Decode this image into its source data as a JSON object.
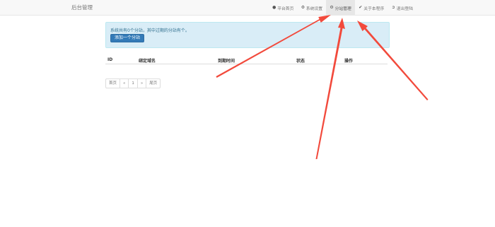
{
  "navbar": {
    "brand": "后台管理",
    "items": [
      {
        "label": "平台首页",
        "icon": "user-icon",
        "active": false
      },
      {
        "label": "系统设置",
        "icon": "gear-icon",
        "active": false
      },
      {
        "label": "分站管理",
        "icon": "gear-icon",
        "active": true
      },
      {
        "label": "关于本程序",
        "icon": "check-icon",
        "active": false
      },
      {
        "label": "退出登陆",
        "icon": "logout-icon",
        "active": false
      }
    ]
  },
  "alert": {
    "message": "系统共有0个分站，其中过期的分站有个。",
    "add_button_label": "添加一个分站"
  },
  "table": {
    "columns": [
      "ID",
      "绑定域名",
      "到期时间",
      "状态",
      "操作"
    ],
    "rows": []
  },
  "pagination": {
    "first": "首页",
    "prev": "«",
    "current": "1",
    "next": "»",
    "last": "尾页"
  },
  "colors": {
    "annotation_arrow": "#f24a3c",
    "alert_bg": "#d9edf7",
    "primary": "#337ab7"
  }
}
